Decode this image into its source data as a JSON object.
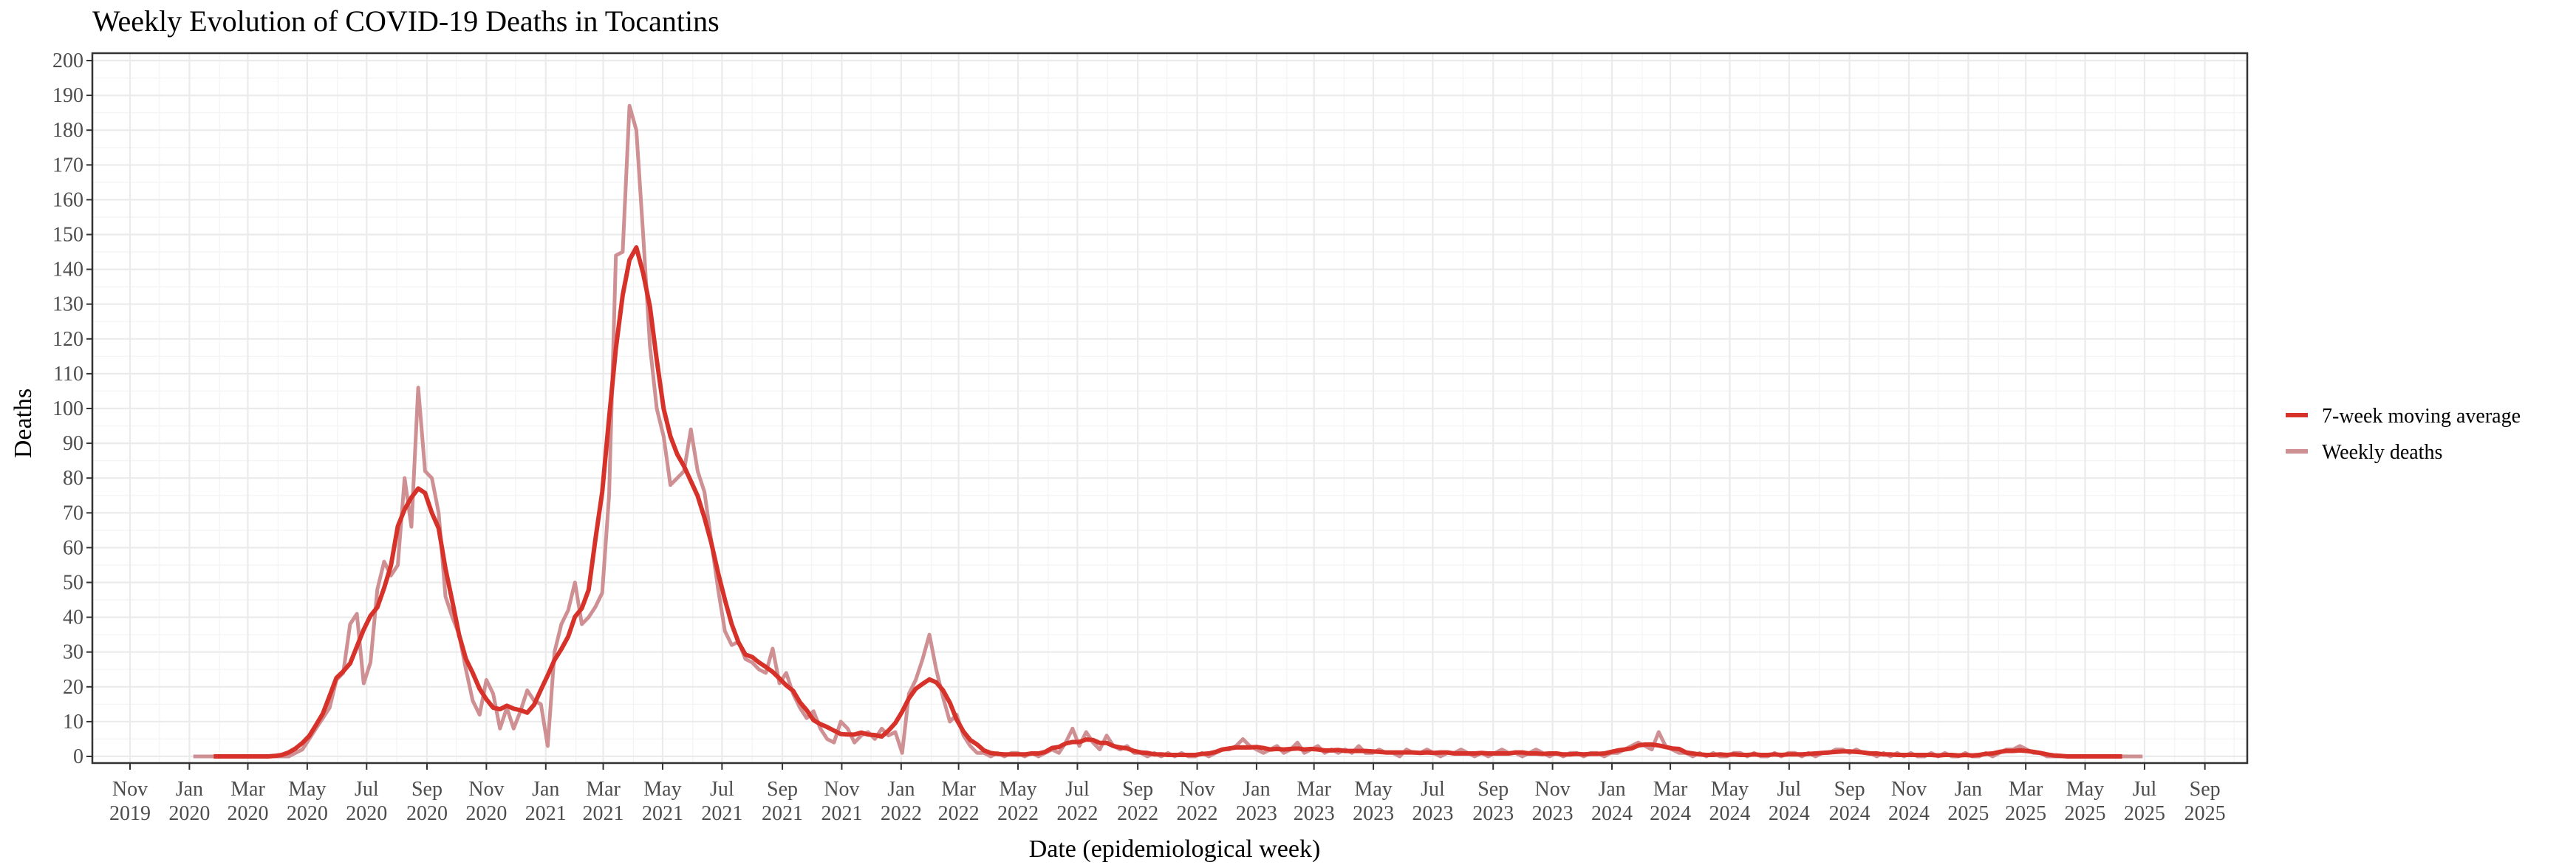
{
  "chart_data": {
    "type": "line",
    "title": "Weekly Evolution of COVID-19 Deaths in Tocantins",
    "xlabel": "Date (epidemiological week)",
    "ylabel": "Deaths",
    "ylim": [
      0,
      200
    ],
    "y_ticks": [
      0,
      10,
      20,
      30,
      40,
      50,
      60,
      70,
      80,
      90,
      100,
      110,
      120,
      130,
      140,
      150,
      160,
      170,
      180,
      190,
      200
    ],
    "x_range": [
      "2019-11-01",
      "2025-09-01"
    ],
    "x_ticks": [
      {
        "month": "Nov",
        "year": "2019"
      },
      {
        "month": "Jan",
        "year": "2020"
      },
      {
        "month": "Mar",
        "year": "2020"
      },
      {
        "month": "May",
        "year": "2020"
      },
      {
        "month": "Jul",
        "year": "2020"
      },
      {
        "month": "Sep",
        "year": "2020"
      },
      {
        "month": "Nov",
        "year": "2020"
      },
      {
        "month": "Jan",
        "year": "2021"
      },
      {
        "month": "Mar",
        "year": "2021"
      },
      {
        "month": "May",
        "year": "2021"
      },
      {
        "month": "Jul",
        "year": "2021"
      },
      {
        "month": "Sep",
        "year": "2021"
      },
      {
        "month": "Nov",
        "year": "2021"
      },
      {
        "month": "Jan",
        "year": "2022"
      },
      {
        "month": "Mar",
        "year": "2022"
      },
      {
        "month": "May",
        "year": "2022"
      },
      {
        "month": "Jul",
        "year": "2022"
      },
      {
        "month": "Sep",
        "year": "2022"
      },
      {
        "month": "Nov",
        "year": "2022"
      },
      {
        "month": "Jan",
        "year": "2023"
      },
      {
        "month": "Mar",
        "year": "2023"
      },
      {
        "month": "May",
        "year": "2023"
      },
      {
        "month": "Jul",
        "year": "2023"
      },
      {
        "month": "Sep",
        "year": "2023"
      },
      {
        "month": "Nov",
        "year": "2023"
      },
      {
        "month": "Jan",
        "year": "2024"
      },
      {
        "month": "Mar",
        "year": "2024"
      },
      {
        "month": "May",
        "year": "2024"
      },
      {
        "month": "Jul",
        "year": "2024"
      },
      {
        "month": "Sep",
        "year": "2024"
      },
      {
        "month": "Nov",
        "year": "2024"
      },
      {
        "month": "Jan",
        "year": "2025"
      },
      {
        "month": "Mar",
        "year": "2025"
      },
      {
        "month": "May",
        "year": "2025"
      },
      {
        "month": "Jul",
        "year": "2025"
      },
      {
        "month": "Sep",
        "year": "2025"
      }
    ],
    "grid": true,
    "legend_position": "right",
    "series": [
      {
        "name": "7-week moving average",
        "color": "#d7322a",
        "derived_from": "Weekly deaths",
        "window_weeks": 7,
        "centered": true
      },
      {
        "name": "Weekly deaths",
        "color": "#cf9094",
        "start_week": "2020-01-05",
        "interval_days": 7,
        "values": [
          0,
          0,
          0,
          0,
          0,
          0,
          0,
          0,
          0,
          0,
          0,
          0,
          0,
          0,
          0,
          1,
          2,
          5,
          8,
          11,
          14,
          22,
          24,
          38,
          41,
          21,
          27,
          48,
          56,
          52,
          55,
          80,
          66,
          106,
          82,
          80,
          70,
          46,
          40,
          35,
          25,
          16,
          12,
          22,
          18,
          8,
          14,
          8,
          13,
          19,
          16,
          15,
          3,
          30,
          38,
          42,
          50,
          38,
          40,
          43,
          47,
          75,
          144,
          145,
          187,
          180,
          150,
          118,
          100,
          92,
          78,
          80,
          82,
          94,
          82,
          76,
          62,
          48,
          36,
          32,
          33,
          28,
          27,
          25,
          24,
          31,
          21,
          24,
          18,
          14,
          11,
          13,
          8,
          5,
          4,
          10,
          8,
          4,
          6,
          7,
          5,
          8,
          6,
          7,
          1,
          18,
          22,
          28,
          35,
          25,
          17,
          10,
          12,
          6,
          3,
          1,
          1,
          0,
          1,
          0,
          1,
          1,
          0,
          1,
          0,
          1,
          2,
          1,
          4,
          8,
          3,
          7,
          4,
          2,
          6,
          3,
          2,
          3,
          1,
          1,
          0,
          1,
          0,
          1,
          0,
          1,
          0,
          0,
          1,
          0,
          1,
          2,
          2,
          3,
          5,
          3,
          2,
          1,
          2,
          3,
          1,
          2,
          4,
          1,
          2,
          3,
          1,
          2,
          1,
          2,
          1,
          3,
          1,
          1,
          2,
          1,
          1,
          0,
          2,
          1,
          1,
          2,
          1,
          0,
          1,
          1,
          2,
          1,
          0,
          1,
          0,
          1,
          2,
          1,
          1,
          0,
          1,
          2,
          1,
          0,
          1,
          0,
          1,
          1,
          0,
          1,
          1,
          0,
          1,
          1,
          2,
          3,
          4,
          3,
          2,
          7,
          3,
          2,
          1,
          1,
          0,
          1,
          0,
          1,
          0,
          0,
          1,
          1,
          0,
          1,
          0,
          0,
          1,
          0,
          1,
          1,
          0,
          1,
          0,
          1,
          1,
          2,
          2,
          1,
          2,
          1,
          1,
          0,
          1,
          0,
          1,
          0,
          1,
          0,
          0,
          1,
          0,
          1,
          0,
          0,
          1,
          0,
          0,
          1,
          0,
          1,
          2,
          2,
          3,
          2,
          1,
          1,
          0,
          0,
          0,
          0,
          0,
          0,
          0,
          0,
          0,
          0,
          0,
          0,
          0,
          0,
          0
        ]
      }
    ]
  }
}
